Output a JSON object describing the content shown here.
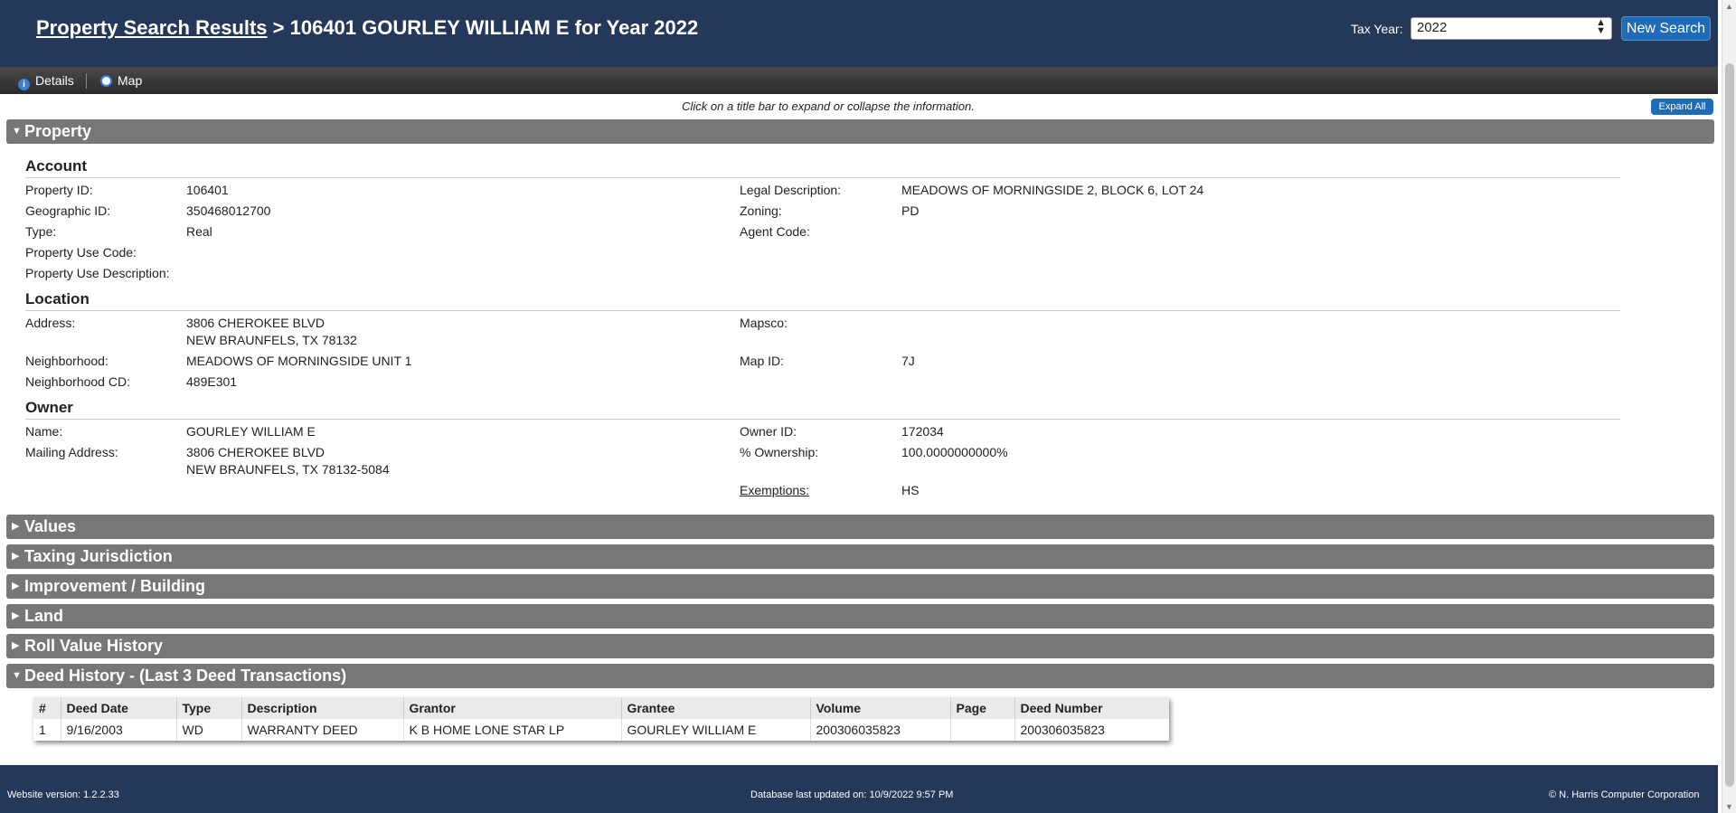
{
  "header": {
    "title_link": "Property Search Results",
    "title_rest": " > 106401 GOURLEY WILLIAM E for Year 2022",
    "tax_year_label": "Tax Year:",
    "tax_year_value": "2022",
    "new_search_label": "New Search"
  },
  "toolbar": {
    "details_label": "Details",
    "map_label": "Map"
  },
  "info_text": "Click on a title bar to expand or collapse the information.",
  "expand_all_label": "Expand All",
  "sections": {
    "property": "Property",
    "values": "Values",
    "taxing": "Taxing Jurisdiction",
    "improvement": "Improvement / Building",
    "land": "Land",
    "roll": "Roll Value History",
    "deed": "Deed History - (Last 3 Deed Transactions)"
  },
  "account": {
    "heading": "Account",
    "property_id_label": "Property ID:",
    "property_id": "106401",
    "geo_id_label": "Geographic ID:",
    "geo_id": "350468012700",
    "type_label": "Type:",
    "type": "Real",
    "use_code_label": "Property Use Code:",
    "use_desc_label": "Property Use Description:",
    "legal_label": "Legal Description:",
    "legal": "MEADOWS OF MORNINGSIDE 2, BLOCK 6, LOT 24",
    "zoning_label": "Zoning:",
    "zoning": "PD",
    "agent_label": "Agent Code:"
  },
  "location": {
    "heading": "Location",
    "address_label": "Address:",
    "address_line1": "3806 CHEROKEE BLVD",
    "address_line2": "NEW BRAUNFELS, TX 78132",
    "neighborhood_label": "Neighborhood:",
    "neighborhood": "MEADOWS OF MORNINGSIDE UNIT 1",
    "neighborhood_cd_label": "Neighborhood CD:",
    "neighborhood_cd": "489E301",
    "mapsco_label": "Mapsco:",
    "map_id_label": "Map ID:",
    "map_id": "7J"
  },
  "owner": {
    "heading": "Owner",
    "name_label": "Name:",
    "name": "GOURLEY WILLIAM E",
    "mailing_label": "Mailing Address:",
    "mailing_line1": "3806 CHEROKEE BLVD",
    "mailing_line2": "NEW BRAUNFELS, TX 78132-5084",
    "owner_id_label": "Owner ID:",
    "owner_id": "172034",
    "ownership_label": "% Ownership:",
    "ownership": "100.0000000000%",
    "exemptions_label": "Exemptions:",
    "exemptions": "HS"
  },
  "deed_table": {
    "headers": [
      "#",
      "Deed Date",
      "Type",
      "Description",
      "Grantor",
      "Grantee",
      "Volume",
      "Page",
      "Deed Number"
    ],
    "rows": [
      [
        "1",
        "9/16/2003",
        "WD",
        "WARRANTY DEED",
        "K B HOME LONE STAR LP",
        "GOURLEY WILLIAM E",
        "200306035823",
        "",
        "200306035823"
      ]
    ]
  },
  "footer": {
    "version": "Website version: 1.2.2.33",
    "db_updated": "Database last updated on: 10/9/2022 9:57 PM",
    "copyright": "© N. Harris Computer Corporation"
  },
  "colors": {
    "header_bg": "#243859",
    "bar_bg": "#777777",
    "accent_button": "#1e6bb8"
  }
}
